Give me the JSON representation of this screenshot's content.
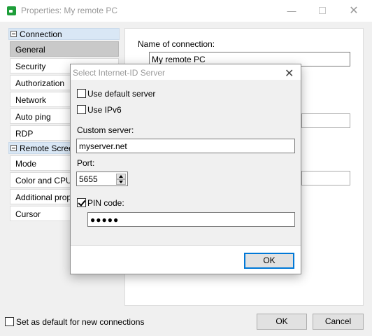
{
  "window": {
    "title": "Properties: My remote PC",
    "minimize_glyph": "—",
    "close_glyph": "✕"
  },
  "sidebar": {
    "groups": [
      {
        "label": "Connection",
        "items": [
          "General",
          "Security",
          "Authorization",
          "Network",
          "Auto ping",
          "RDP"
        ]
      },
      {
        "label": "Remote Screen",
        "items": [
          "Mode",
          "Color and CPU",
          "Additional properties",
          "Cursor"
        ]
      }
    ],
    "selected": "General"
  },
  "content": {
    "connection_name_label": "Name of connection:",
    "connection_name_value": "My remote PC"
  },
  "footer": {
    "default_checkbox_label": "Set as default for new connections",
    "default_checked": false,
    "ok_label": "OK",
    "cancel_label": "Cancel"
  },
  "dialog": {
    "title": "Select Internet-ID Server",
    "close_glyph": "✕",
    "use_default_server_label": "Use default server",
    "use_default_server_checked": false,
    "use_ipv6_label": "Use IPv6",
    "use_ipv6_checked": false,
    "custom_server_label": "Custom server:",
    "custom_server_value": "myserver.net",
    "port_label": "Port:",
    "port_value": "5655",
    "pin_code_label": "PIN code:",
    "pin_code_checked": true,
    "pin_code_value": "●●●●●",
    "ok_label": "OK"
  }
}
